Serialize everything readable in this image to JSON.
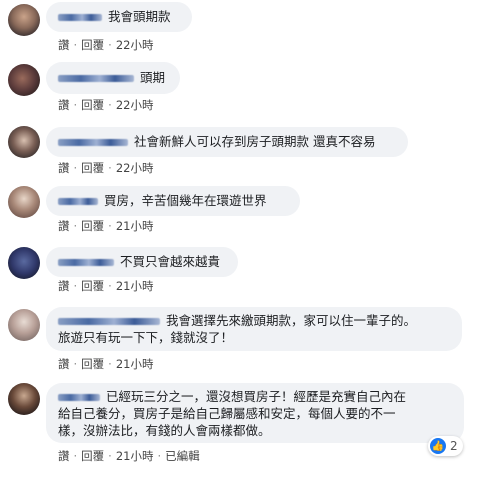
{
  "meta_labels": {
    "like": "讚",
    "reply": "回覆",
    "separator": "·",
    "edited": "已編輯"
  },
  "comments": [
    {
      "text": "我會頭期款",
      "time": "22小時"
    },
    {
      "text": "頭期",
      "time": "22小時"
    },
    {
      "text": "社會新鮮人可以存到房子頭期款 還真不容易",
      "time": "22小時"
    },
    {
      "text": "買房，辛苦個幾年在環遊世界",
      "time": "21小時"
    },
    {
      "text": "不買只會越來越貴",
      "time": "21小時"
    },
    {
      "text": "我會選擇先來繳頭期款，家可以住一輩子的。",
      "line2": "旅遊只有玩一下下，錢就沒了！",
      "time": "21小時"
    },
    {
      "text": "已經玩三分之一，還沒想買房子！經歷是充實自己內在",
      "line2": "給自己養分，買房子是給自己歸屬感和安定，每個人要的不一",
      "line3": "樣，沒辦法比，有錢的人會兩樣都做。",
      "time": "21小時",
      "reaction_count": "2"
    }
  ]
}
